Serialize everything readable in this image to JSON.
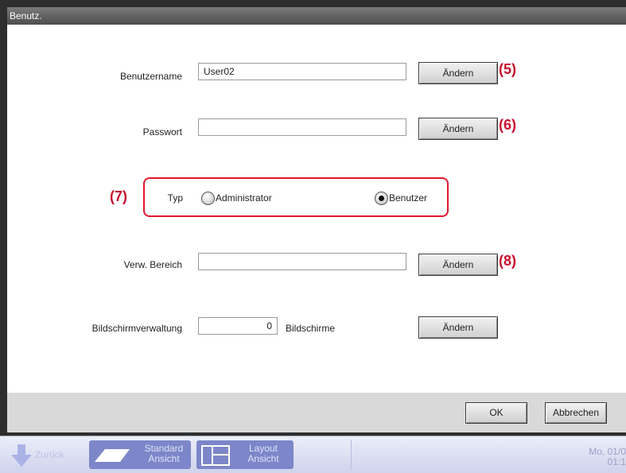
{
  "window": {
    "title": "Benutz."
  },
  "form": {
    "username": {
      "label": "Benutzername",
      "value": "User02",
      "button": "Ändern",
      "annotation": "(5)"
    },
    "password": {
      "label": "Passwort",
      "value": "",
      "button": "Ändern",
      "annotation": "(6)"
    },
    "type": {
      "label": "Typ",
      "annotation": "(7)",
      "options": [
        {
          "label": "Administrator",
          "selected": false
        },
        {
          "label": "Benutzer",
          "selected": true
        }
      ]
    },
    "area": {
      "label": "Verw. Bereich",
      "value": "",
      "button": "Ändern",
      "annotation": "(8)"
    },
    "screens": {
      "label": "Bildschirmverwaltung",
      "value": "0",
      "unit": "Bildschirme",
      "button": "Ändern"
    }
  },
  "footer": {
    "ok": "OK",
    "cancel": "Abbrechen"
  },
  "taskbar": {
    "back": "Zurück",
    "standard_line1": "Standard",
    "standard_line2": "Ansicht",
    "layout_line1": "Layout",
    "layout_line2": "Ansicht",
    "clock_line1": "Mo, 01/0",
    "clock_line2": "01:1"
  },
  "colors": {
    "annotation": "#c8102e",
    "highlight_box": "#e0182e",
    "taskbar_button": "#7d86c9"
  }
}
